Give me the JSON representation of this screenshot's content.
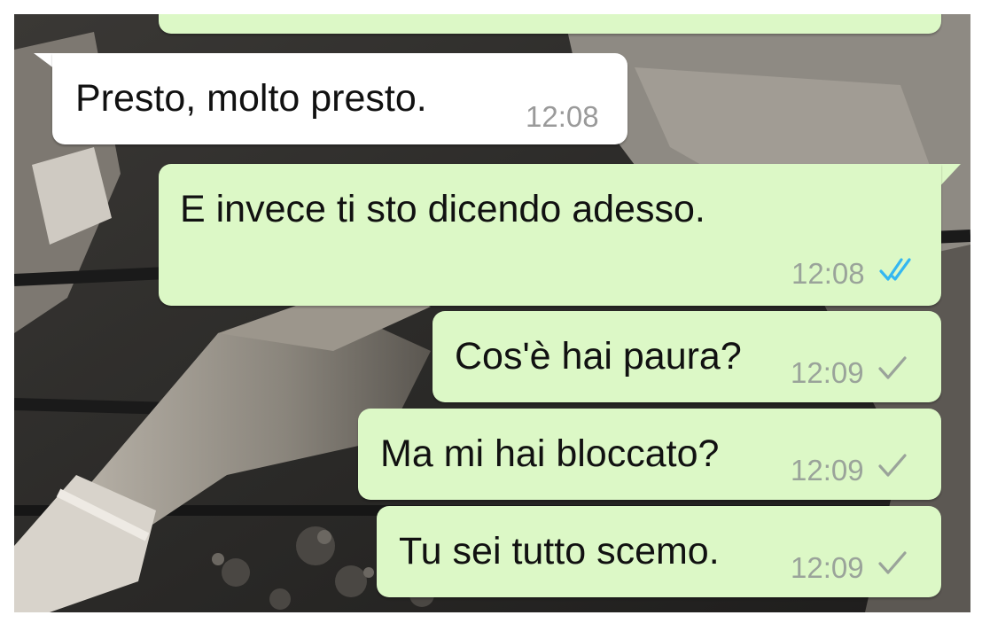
{
  "colors": {
    "outgoing_bubble": "#dcf8c6",
    "incoming_bubble": "#ffffff",
    "timestamp": "#9aa39a",
    "read_ticks": "#34b7f1",
    "sent_tick": "#9aa39a"
  },
  "messages": [
    {
      "direction": "outgoing",
      "text": "",
      "time": "",
      "status": ""
    },
    {
      "direction": "incoming",
      "text": "Presto, molto presto.",
      "time": "12:08"
    },
    {
      "direction": "outgoing",
      "text": "E invece ti sto dicendo adesso.",
      "time": "12:08",
      "status": "read",
      "status_icon": "double-check-icon"
    },
    {
      "direction": "outgoing",
      "text": "Cos'è hai paura?",
      "time": "12:09",
      "status": "sent",
      "status_icon": "single-check-icon"
    },
    {
      "direction": "outgoing",
      "text": "Ma mi hai bloccato?",
      "time": "12:09",
      "status": "sent",
      "status_icon": "single-check-icon"
    },
    {
      "direction": "outgoing",
      "text": "Tu sei tutto scemo.",
      "time": "12:09",
      "status": "sent",
      "status_icon": "single-check-icon"
    }
  ]
}
